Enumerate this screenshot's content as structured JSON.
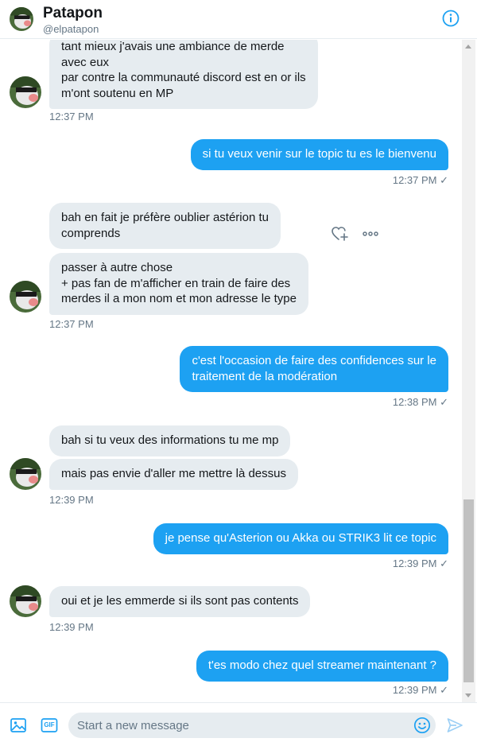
{
  "header": {
    "title": "Patapon",
    "handle": "@elpatapon"
  },
  "messages": [
    {
      "text": "tant mieux j'avais une ambiance de merde\navec eux\npar contre la communauté discord est en or ils\nm'ont soutenu en MP"
    },
    {
      "text": "si tu veux venir sur le topic tu es le bienvenu"
    },
    {
      "text": "bah en fait je préfère oublier astérion tu\ncomprends"
    },
    {
      "text": "passer à autre chose\n+ pas fan de m'afficher en train de faire des\nmerdes il a mon nom et mon adresse le type"
    },
    {
      "text": "c'est l'occasion de faire des confidences sur le\ntraitement de la modération"
    },
    {
      "text": "bah si tu veux des informations tu me mp"
    },
    {
      "text": "mais pas envie d'aller me mettre là dessus"
    },
    {
      "text": "je pense qu'Asterion ou Akka ou STRIK3 lit ce topic"
    },
    {
      "text": "oui et je les emmerde si ils sont pas contents"
    },
    {
      "text": "t'es modo chez quel streamer maintenant ?"
    }
  ],
  "timestamps": [
    {
      "text": "12:37 PM"
    },
    {
      "text": "12:37 PM ✓"
    },
    {
      "text": "12:37 PM"
    },
    {
      "text": "12:38 PM ✓"
    },
    {
      "text": "12:39 PM"
    },
    {
      "text": "12:39 PM ✓"
    },
    {
      "text": "12:39 PM"
    },
    {
      "text": "12:39 PM ✓"
    }
  ],
  "composer": {
    "placeholder": "Start a new message",
    "gif_label": "GIF"
  },
  "icons": {
    "info": "info-icon",
    "like": "heart-plus-icon",
    "more": "more-icon",
    "media": "image-icon",
    "gif": "gif-icon",
    "emoji": "emoji-icon",
    "send": "send-icon"
  },
  "colors": {
    "accent": "#1da1f2",
    "incoming_bubble": "#e6ecf0",
    "muted_text": "#657786"
  }
}
